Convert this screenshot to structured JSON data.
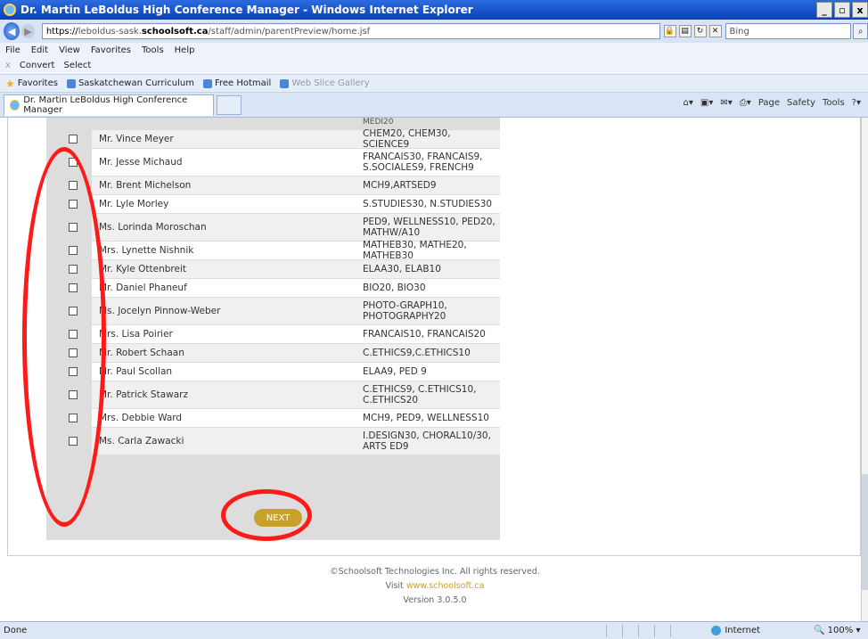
{
  "window": {
    "title": "Dr. Martin LeBoldus High Conference Manager - Windows Internet Explorer",
    "controls": [
      "_",
      "e",
      "x"
    ]
  },
  "address": {
    "https": "https://",
    "url_domain_prefix": "leboldus-sask.",
    "url_domain": "schoolsoft.ca",
    "url_path": "/staff/admin/parentPreview/home.jsf",
    "search_placeholder": "Bing"
  },
  "menu": [
    "File",
    "Edit",
    "View",
    "Favorites",
    "Tools",
    "Help"
  ],
  "commands": {
    "convert": "Convert",
    "select": "Select"
  },
  "favorites": {
    "label": "Favorites",
    "items": [
      "Saskatchewan Curriculum",
      "Free Hotmail",
      "Web Slice Gallery"
    ]
  },
  "tab": {
    "title": "Dr. Martin LeBoldus High Conference Manager"
  },
  "tabtools": [
    "Page",
    "Safety",
    "Tools"
  ],
  "partial_top": "MEDI20",
  "teachers": [
    {
      "name": "Mr. Vince Meyer",
      "courses": "CHEM20, CHEM30, SCIENCE9"
    },
    {
      "name": "Mr. Jesse Michaud",
      "courses": "FRANCAIS30, FRANCAIS9, S.SOCIALES9, FRENCH9"
    },
    {
      "name": "Mr. Brent Michelson",
      "courses": "MCH9,ARTSED9"
    },
    {
      "name": "Mr. Lyle Morley",
      "courses": "S.STUDIES30, N.STUDIES30"
    },
    {
      "name": "Ms. Lorinda Moroschan",
      "courses": "PED9, WELLNESS10, PED20, MATHW/A10"
    },
    {
      "name": "Mrs. Lynette Nishnik",
      "courses": "MATHEB30, MATHE20, MATHEB30"
    },
    {
      "name": "Mr. Kyle Ottenbreit",
      "courses": "ELAA30, ELAB10"
    },
    {
      "name": "Mr. Daniel Phaneuf",
      "courses": "BIO20, BIO30"
    },
    {
      "name": "Ms. Jocelyn Pinnow-Weber",
      "courses": "PHOTO-GRAPH10, PHOTOGRAPHY20"
    },
    {
      "name": "Mrs. Lisa Poirier",
      "courses": "FRANCAIS10, FRANCAIS20"
    },
    {
      "name": "Mr. Robert Schaan",
      "courses": "C.ETHICS9,C.ETHICS10"
    },
    {
      "name": "Mr. Paul Scollan",
      "courses": "ELAA9, PED 9"
    },
    {
      "name": "Mr. Patrick Stawarz",
      "courses": "C.ETHICS9, C.ETHICS10, C.ETHICS20"
    },
    {
      "name": "Mrs. Debbie Ward",
      "courses": "MCH9, PED9, WELLNESS10"
    },
    {
      "name": "Ms. Carla Zawacki",
      "courses": "I.DESIGN30, CHORAL10/30, ARTS ED9"
    }
  ],
  "next_label": "NEXT",
  "footer": {
    "copyright": "©Schoolsoft Technologies Inc. All rights reserved.",
    "visit": "Visit",
    "link": "www.schoolsoft.ca",
    "version": "Version 3.0.5.0"
  },
  "status": {
    "left": "Done",
    "zone": "Internet",
    "zoom": "100%"
  }
}
